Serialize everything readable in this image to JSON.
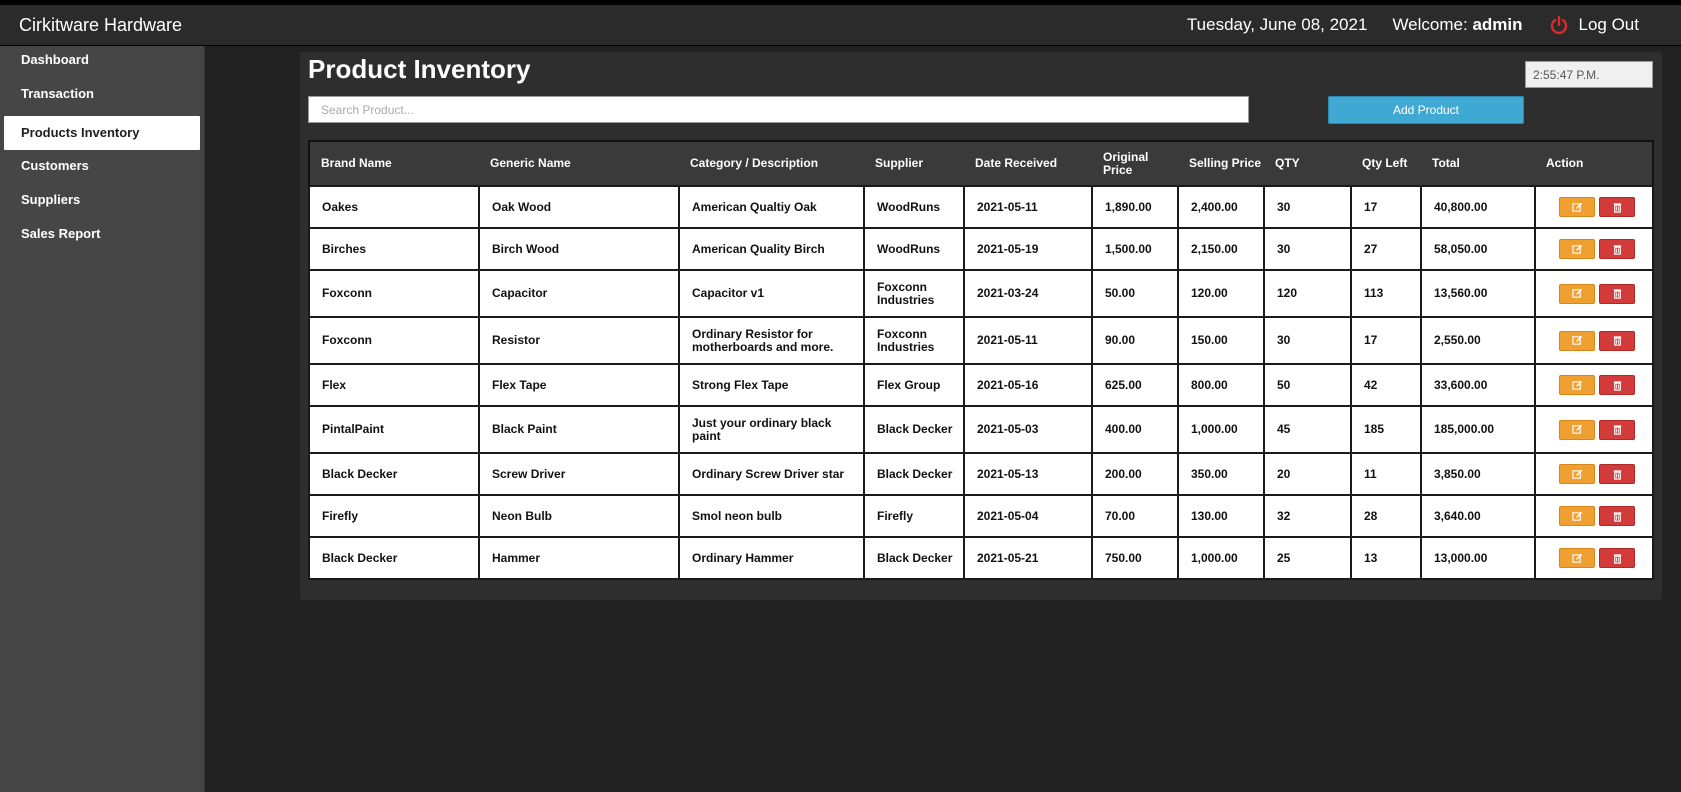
{
  "header": {
    "app_title": "Cirkitware Hardware",
    "date": "Tuesday, June 08, 2021",
    "welcome_label": "Welcome:",
    "username": "admin",
    "logout_label": "Log Out"
  },
  "sidebar": {
    "items": [
      {
        "label": "Dashboard",
        "active": false
      },
      {
        "label": "Transaction",
        "active": false
      },
      {
        "label": "Products Inventory",
        "active": true
      },
      {
        "label": "Customers",
        "active": false
      },
      {
        "label": "Suppliers",
        "active": false
      },
      {
        "label": "Sales Report",
        "active": false
      }
    ]
  },
  "main": {
    "title": "Product Inventory",
    "clock": "2:55:47 P.M.",
    "search_placeholder": "Search Product...",
    "add_button": "Add Product"
  },
  "table": {
    "headers": [
      "Brand Name",
      "Generic Name",
      "Category / Description",
      "Supplier",
      "Date Received",
      "Original Price",
      "Selling Price",
      "QTY",
      "Qty Left",
      "Total",
      "Action"
    ],
    "rows": [
      [
        "Oakes",
        "Oak Wood",
        "American Qualtiy Oak",
        "WoodRuns",
        "2021-05-11",
        "1,890.00",
        "2,400.00",
        "30",
        "17",
        "40,800.00"
      ],
      [
        "Birches",
        "Birch Wood",
        "American Quality Birch",
        "WoodRuns",
        "2021-05-19",
        "1,500.00",
        "2,150.00",
        "30",
        "27",
        "58,050.00"
      ],
      [
        "Foxconn",
        "Capacitor",
        "Capacitor v1",
        "Foxconn Industries",
        "2021-03-24",
        "50.00",
        "120.00",
        "120",
        "113",
        "13,560.00"
      ],
      [
        "Foxconn",
        "Resistor",
        "Ordinary Resistor for motherboards and more.",
        "Foxconn Industries",
        "2021-05-11",
        "90.00",
        "150.00",
        "30",
        "17",
        "2,550.00"
      ],
      [
        "Flex",
        "Flex Tape",
        "Strong Flex Tape",
        "Flex Group",
        "2021-05-16",
        "625.00",
        "800.00",
        "50",
        "42",
        "33,600.00"
      ],
      [
        "PintalPaint",
        "Black Paint",
        "Just your ordinary black paint",
        "Black Decker",
        "2021-05-03",
        "400.00",
        "1,000.00",
        "45",
        "185",
        "185,000.00"
      ],
      [
        "Black Decker",
        "Screw Driver",
        "Ordinary  Screw Driver star",
        "Black Decker",
        "2021-05-13",
        "200.00",
        "350.00",
        "20",
        "11",
        "3,850.00"
      ],
      [
        "Firefly",
        "Neon Bulb",
        "Smol neon bulb",
        "Firefly",
        "2021-05-04",
        "70.00",
        "130.00",
        "32",
        "28",
        "3,640.00"
      ],
      [
        "Black Decker",
        "Hammer",
        "Ordinary Hammer",
        "Black Decker",
        "2021-05-21",
        "750.00",
        "1,000.00",
        "25",
        "13",
        "13,000.00"
      ]
    ]
  },
  "colors": {
    "topbar": "#2b2b2b",
    "sidebar": "#464646",
    "main_bg": "#222222",
    "panel": "#2e2e2e",
    "add_button": "#3fa9d4",
    "edit_button": "#f0a030",
    "delete_button": "#d33b3b",
    "logout_icon": "#e02a2a"
  },
  "icons": {
    "logout": "power-icon",
    "edit": "edit-icon",
    "delete": "trash-icon"
  }
}
